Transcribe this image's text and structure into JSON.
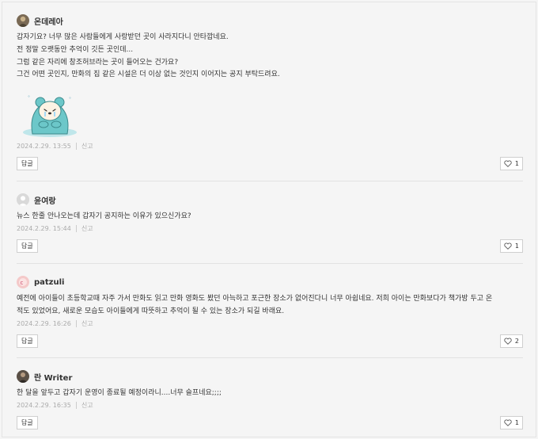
{
  "comments": [
    {
      "author": "온데레아",
      "lines": [
        "갑자기요? 너무 많은 사람들에게 사랑받던 곳이 사라지다니 안타깝네요.",
        "전 정말 오랫동안 추억이 깃든 곳인데...",
        "그럼 같은 자리에 창조허브라는 곳이 들어오는 건가요?",
        "그건 어떤 곳인지, 만화의 집 같은 시설은 더 이상 없는 것인지 이어지는 공지 부탁드려요."
      ],
      "sticker": "crying-bear-sticker",
      "date": "2024.2.29. 13:55",
      "report": "신고",
      "reply": "답글",
      "likes": "1"
    },
    {
      "author": "윤여랑",
      "lines": [
        "뉴스 한줄 안나오는데 갑자기 공지하는 이유가 있으신가요?"
      ],
      "date": "2024.2.29. 15:44",
      "report": "신고",
      "reply": "답글",
      "likes": "1"
    },
    {
      "author": "patzuli",
      "lines": [
        "예전에 아이들이 초등학교때 자주 가서 만화도 읽고 만화 영화도 봤던 아늑하고 포근한 장소가 없어진다니 너무 아쉽네요. 저희 아이는 만화보다가 책가방 두고 온",
        "적도 있었어요, 새로운 모습도 아이들에게 따뜻하고 추억이 될 수 있는 장소가 되길 바래요."
      ],
      "date": "2024.2.29. 16:26",
      "report": "신고",
      "reply": "답글",
      "likes": "2"
    },
    {
      "author": "란 Writer",
      "lines": [
        "한 달을 앞두고 갑자기 운영이 종료될 예정이라니....너무 슬프네요;;;;"
      ],
      "date": "2024.2.29. 16:35",
      "report": "신고",
      "reply": "답글",
      "likes": "1"
    }
  ],
  "colors": {
    "background": "#f5f5f5",
    "meta": "#aaaaaa",
    "sticker": "#6cc7c9",
    "divider": "#e2e2e2"
  },
  "icons": {
    "like": "heart-icon",
    "avatar_default": "person-icon"
  }
}
